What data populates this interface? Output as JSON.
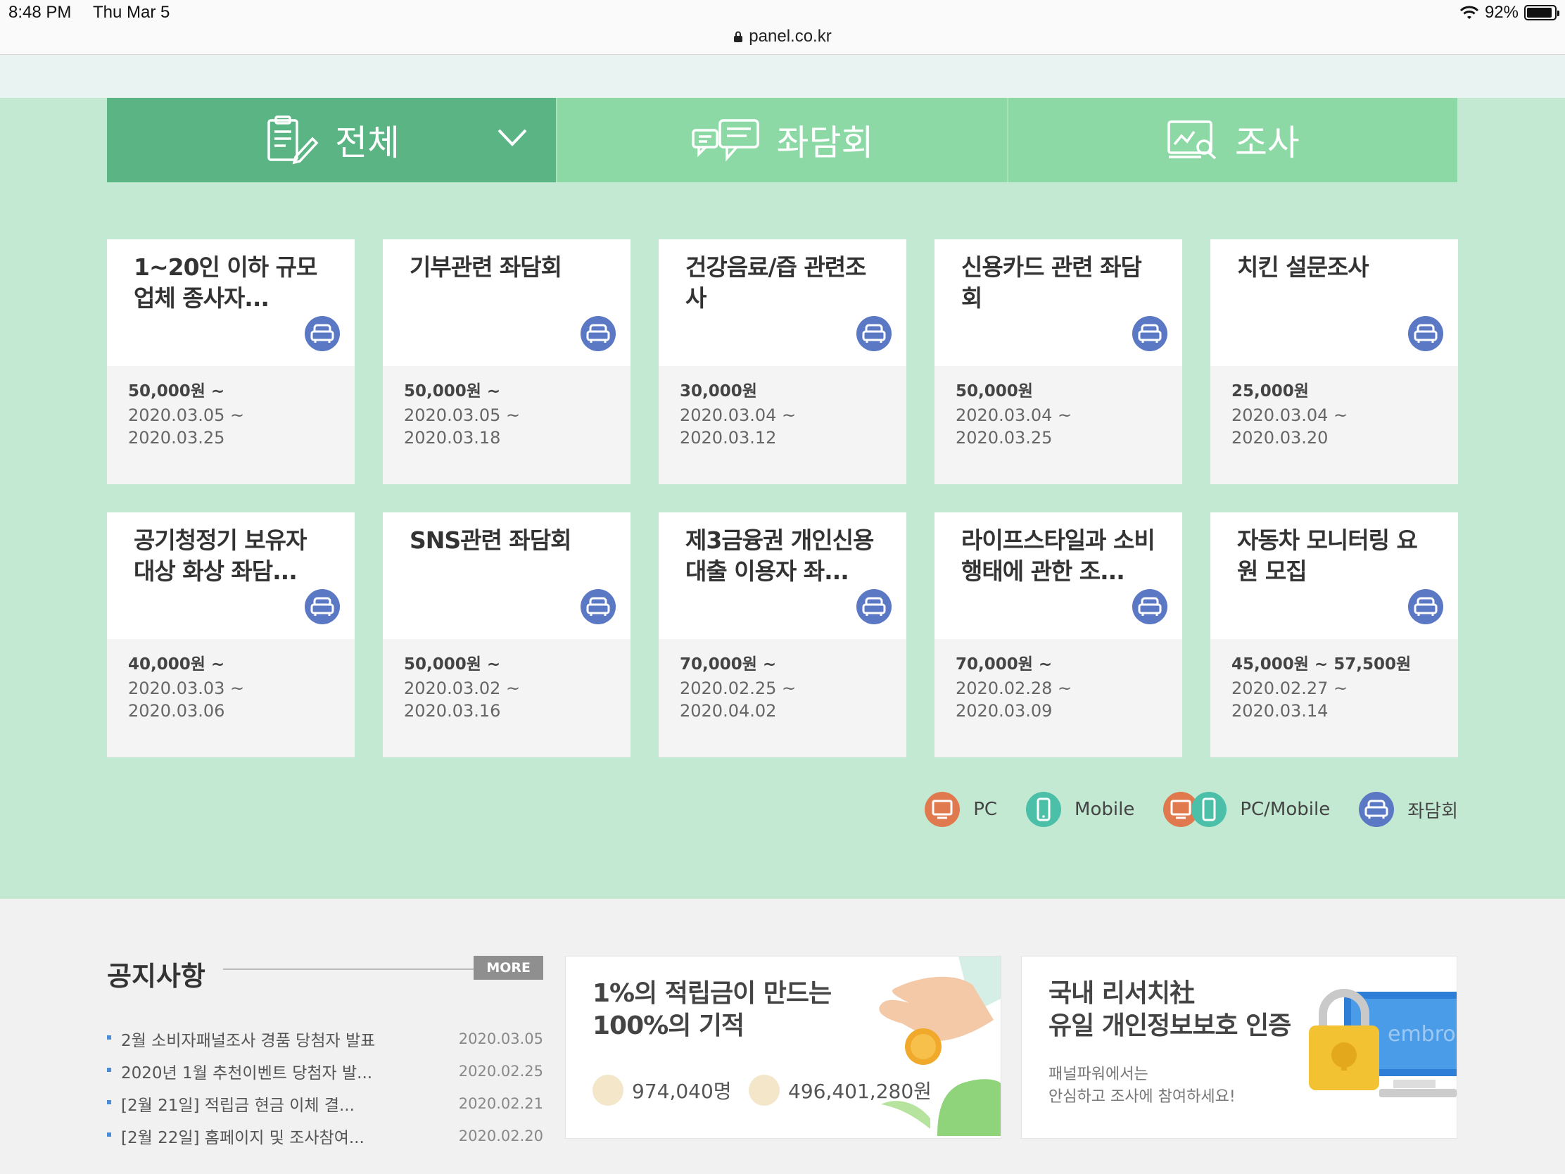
{
  "status": {
    "time": "8:48 PM",
    "date": "Thu Mar 5",
    "url": "panel.co.kr",
    "battery": "92%",
    "battery_level": 0.92
  },
  "tabs": [
    {
      "label": "전체",
      "icon": "clipboard-edit-icon"
    },
    {
      "label": "좌담회",
      "icon": "chat-bubbles-icon"
    },
    {
      "label": "조사",
      "icon": "chart-search-icon"
    }
  ],
  "cards": [
    {
      "title": "1~20인 이하 규모 업체 종사자...",
      "price": "50,000원 ~",
      "period": "2020.03.05 ~ 2020.03.25",
      "icon": "sofa-icon"
    },
    {
      "title": "기부관련 좌담회",
      "price": "50,000원 ~",
      "period": "2020.03.05 ~ 2020.03.18",
      "icon": "sofa-icon"
    },
    {
      "title": "건강음료/즙 관련조사",
      "price": "30,000원",
      "period": "2020.03.04 ~ 2020.03.12",
      "icon": "sofa-icon"
    },
    {
      "title": "신용카드 관련 좌담회",
      "price": "50,000원",
      "period": "2020.03.04 ~ 2020.03.25",
      "icon": "sofa-icon"
    },
    {
      "title": "치킨 설문조사",
      "price": "25,000원",
      "period": "2020.03.04 ~ 2020.03.20",
      "icon": "sofa-icon"
    },
    {
      "title": "공기청정기 보유자 대상 화상 좌담...",
      "price": "40,000원 ~",
      "period": "2020.03.03 ~ 2020.03.06",
      "icon": "sofa-icon"
    },
    {
      "title": "SNS관련 좌담회",
      "price": "50,000원 ~",
      "period": "2020.03.02 ~ 2020.03.16",
      "icon": "sofa-icon"
    },
    {
      "title": "제3금융권 개인신용대출 이용자 좌...",
      "price": "70,000원 ~",
      "period": "2020.02.25 ~ 2020.04.02",
      "icon": "sofa-icon"
    },
    {
      "title": "라이프스타일과 소비행태에 관한 조...",
      "price": "70,000원 ~",
      "period": "2020.02.28 ~ 2020.03.09",
      "icon": "sofa-icon"
    },
    {
      "title": "자동차 모니터링 요원 모집",
      "price": "45,000원 ~ 57,500원",
      "period": "2020.02.27 ~ 2020.03.14",
      "icon": "sofa-icon"
    }
  ],
  "legend": [
    {
      "label": "PC",
      "icon": "pc-icon",
      "color": "#e07a4e"
    },
    {
      "label": "Mobile",
      "icon": "mobile-icon",
      "color": "#4bbfa8"
    },
    {
      "label": "PC/Mobile",
      "icon": "pc-mobile-icon",
      "color": "#e07a4e"
    },
    {
      "label": "좌담회",
      "icon": "sofa-icon",
      "color": "#5a78c4"
    }
  ],
  "notice": {
    "title": "공지사항",
    "more": "MORE",
    "items": [
      {
        "text": "2월 소비자패널조사 경품 당첨자 발표",
        "date": "2020.03.05"
      },
      {
        "text": "2020년 1월 추천이벤트 당첨자 발...",
        "date": "2020.02.25"
      },
      {
        "text": "[2월 21일] 적립금 현금 이체 결...",
        "date": "2020.02.21"
      },
      {
        "text": "[2월 22일] 홈페이지 및 조사참여...",
        "date": "2020.02.20"
      }
    ]
  },
  "banner1": {
    "line1": "1%의 적립금이 만드는",
    "line2": "100%의 기적",
    "members": "974,040명",
    "points": "496,401,280원"
  },
  "banner2": {
    "line1": "국내 리서치社",
    "line2": "유일 개인정보보호 인증",
    "sub1": "패널파워에서는",
    "sub2": "안심하고 조사에 참여하세요!",
    "screen_text": "embro"
  },
  "colors": {
    "tab_active": "#5ab484",
    "tab": "#8dd9a6",
    "section": "#c3e9d3",
    "sofa": "#5a78c4"
  }
}
